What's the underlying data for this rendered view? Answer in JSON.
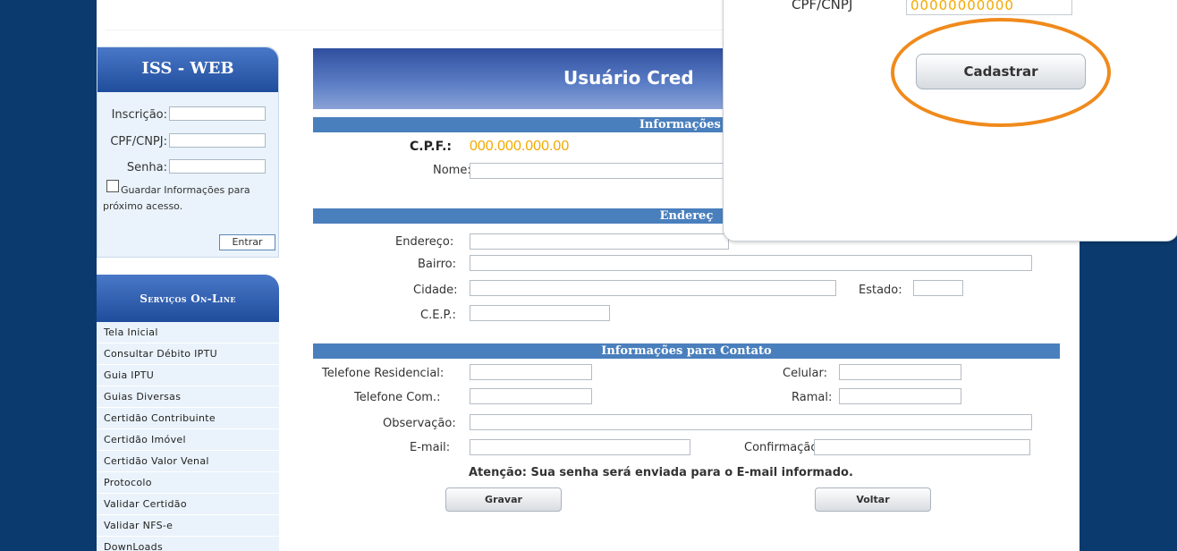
{
  "login": {
    "title": "ISS - WEB",
    "inscricao_label": "Inscrição:",
    "cpfcnpj_label": "CPF/CNPJ:",
    "senha_label": "Senha:",
    "inscricao_value": "",
    "cpfcnpj_value": "",
    "senha_value": "",
    "remember_text": "Guardar Informações para próximo acesso.",
    "remember_checked": false,
    "entrar_label": "Entrar"
  },
  "services": {
    "title": "Serviços On-Line",
    "items": [
      "Tela Inicial",
      "Consultar Débito IPTU",
      "Guia IPTU",
      "Guias Diversas",
      "Certidão Contribuinte",
      "Certidão Imóvel",
      "Certidão Valor Venal",
      "Protocolo",
      "Validar Certidão",
      "Validar NFS-e",
      "DownLoads"
    ]
  },
  "form": {
    "banner_title": "Usuário Cred",
    "sec_pessoais": "Informações P",
    "cpf_label": "C.P.F.:",
    "cpf_value": "000.000.000.00",
    "nome_label": "Nome:",
    "sec_endereco": "Endereç",
    "endereco_label": "Endereço:",
    "bairro_label": "Bairro:",
    "cidade_label": "Cidade:",
    "estado_label": "Estado:",
    "cep_label": "C.E.P.:",
    "sec_contato": "Informações para Contato",
    "tel_res_label": "Telefone Residencial:",
    "celular_label": "Celular:",
    "tel_com_label": "Telefone Com.:",
    "ramal_label": "Ramal:",
    "obs_label": "Observação:",
    "email_label": "E-mail:",
    "confirm_label": "Confirmação:",
    "warning": "Atenção: Sua senha será enviada para o E-mail informado.",
    "gravar_label": "Gravar",
    "voltar_label": "Voltar"
  },
  "popup": {
    "label": "CPF/CNPJ",
    "value": "00000000000",
    "cadastrar_label": "Cadastrar"
  },
  "colors": {
    "sidebar": "#0b3a6e",
    "header_blue": "#1f4d9c",
    "section_bar": "#4a7fbd",
    "highlight_orange": "#f08a1c",
    "cpf_value": "#f2a900"
  }
}
